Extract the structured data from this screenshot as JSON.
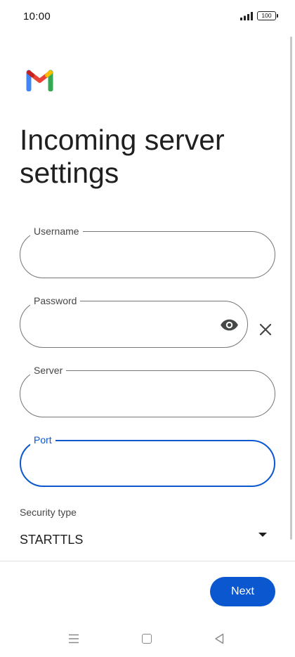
{
  "status_bar": {
    "time": "10:00",
    "battery": "100",
    "signal_icon": "signal-bars-icon",
    "battery_icon": "battery-icon"
  },
  "header": {
    "logo_icon": "gmail-logo-icon",
    "title": "Incoming server settings"
  },
  "form": {
    "username": {
      "label": "Username",
      "value": ""
    },
    "password": {
      "label": "Password",
      "value": "",
      "visibility_icon": "eye-icon"
    },
    "server": {
      "label": "Server",
      "value": ""
    },
    "port": {
      "label": "Port",
      "value": "",
      "focused": true
    },
    "clear_icon": "close-icon",
    "security_type": {
      "label": "Security type",
      "selected": "STARTTLS",
      "icon": "dropdown-arrow-icon"
    }
  },
  "footer": {
    "next_label": "Next"
  },
  "nav_bar": {
    "items": [
      "menu-icon",
      "home-icon",
      "back-icon"
    ]
  },
  "colors": {
    "accent": "#0b57d0",
    "outline": "#747775",
    "text": "#1f1f1f",
    "label": "#444746"
  }
}
